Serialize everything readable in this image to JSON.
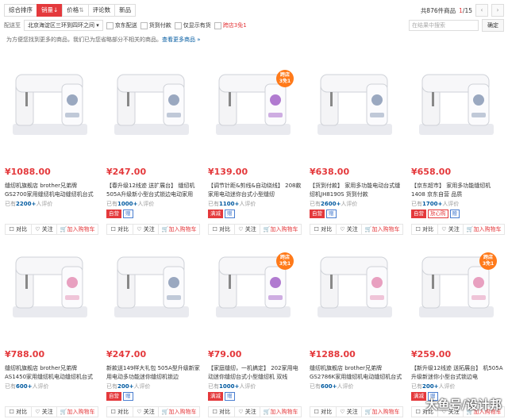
{
  "sort": {
    "tabs": [
      "综合排序",
      "销量",
      "价格",
      "评论数",
      "新品"
    ],
    "total": "共876件商品",
    "page": "1",
    "pages": "/15"
  },
  "filters": {
    "label": "配送至",
    "address": "北京海淀区三环到四环之间",
    "checks": [
      "京东配送",
      "货到付款",
      "仅显示有货",
      "跨店3免1"
    ],
    "search_placeholder": "在结果中搜索",
    "search_button": "确定"
  },
  "tip": {
    "text": "为方便您找到更多的商品，我们已为您省略部分不相关的商品。",
    "link": "查看更多商品 »"
  },
  "actions": {
    "compare": "对比",
    "follow": "关注",
    "cart": "加入购物车"
  },
  "products": [
    {
      "price": "¥1088.00",
      "title": "缝纫机旗舰店 brother兄弟牌 GS2700家用缝纫机电动缝纫机台式",
      "count": "2200+",
      "tail": "人评价",
      "tags": [],
      "badge": ""
    },
    {
      "price": "¥247.00",
      "title": "【春升级12线迹 送扩展台】 缝纫机505A升级新小型台式锁边电动家用",
      "count": "1000+",
      "tail": "人评价",
      "tags": [
        "自营",
        "赠"
      ],
      "badge": ""
    },
    {
      "price": "¥139.00",
      "title": "【调节针距&剪线&自动绕线】 208款家用电动迷你台式小型缝纫",
      "count": "1100+",
      "tail": "人评价",
      "tags": [
        "满减",
        "赠"
      ],
      "badge": "跨店\n3免1"
    },
    {
      "price": "¥638.00",
      "title": "【货到付款】 家用多功能电动台式缝纫机JH8190S 货到付款",
      "count": "2600+",
      "tail": "人评价",
      "tags": [
        "自营",
        "赠"
      ],
      "badge": ""
    },
    {
      "price": "¥658.00",
      "title": "【京东超市】 家用多功能缝纫机1408 京东自营 品质",
      "count": "1700+",
      "tail": "人评价",
      "tags": [
        "自营",
        "放心购",
        "赠"
      ],
      "badge": ""
    },
    {
      "price": "¥788.00",
      "title": "缝纫机旗舰店 brother兄弟牌 AS1450家用缝纫机电动缝纫机台式",
      "count": "600+",
      "tail": "人评价",
      "tags": [],
      "badge": ""
    },
    {
      "price": "¥247.00",
      "title": "新款送149样大礼包 505A型升级新家用电动多功能迷你缝纫机锁边",
      "count": "200+",
      "tail": "人评价",
      "tags": [
        "自营",
        "赠"
      ],
      "badge": ""
    },
    {
      "price": "¥79.00",
      "title": "【家庭缝纫，一机搞定】 202家用电动迷你缝纫台式小型缝纫机 双线",
      "count": "1000+",
      "tail": "人评价",
      "tags": [
        "满减",
        "赠"
      ],
      "badge": "跨店\n3免1"
    },
    {
      "price": "¥1288.00",
      "title": "缝纫机旗舰店 brother兄弟牌 GS2786K家用缝纫机电动缝纫机台式",
      "count": "600+",
      "tail": "人评价",
      "tags": [],
      "badge": ""
    },
    {
      "price": "¥259.00",
      "title": "【新升级12线迹 送拓展台】 机505A 升级新迷你小型台式锁边电",
      "count": "200+",
      "tail": "人评价",
      "tags": [
        "满减",
        "赠"
      ],
      "badge": "跨店\n3免1"
    }
  ],
  "watermark": "大鱼号/设计邦",
  "colors": {
    "accent": "#e4393c",
    "badge": "#ff7a1a",
    "link": "#005aa0"
  }
}
